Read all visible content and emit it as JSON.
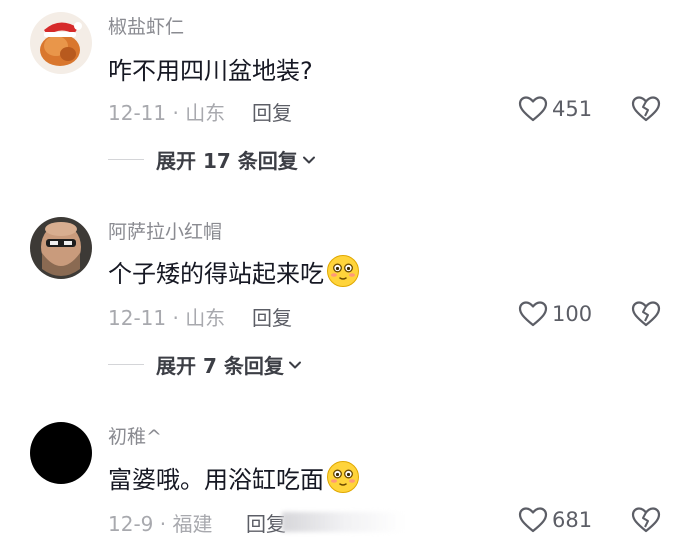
{
  "comments": [
    {
      "username": "椒盐虾仁",
      "text": "咋不用四川盆地装?",
      "meta": "12-11 · 山东",
      "reply_label": "回复",
      "likes": "451",
      "expand_label": "展开 17 条回复"
    },
    {
      "username": "阿萨拉小红帽",
      "text": "个子矮的得站起来吃",
      "meta": "12-11 · 山东",
      "reply_label": "回复",
      "likes": "100",
      "expand_label": "展开 7 条回复"
    },
    {
      "username": "初稚^",
      "text": "富婆哦。用浴缸吃面",
      "meta": "12-9 · 福建",
      "reply_label": "回复",
      "likes": "681"
    }
  ],
  "icons": {
    "like": "heart-outline-icon",
    "dislike": "broken-heart-icon",
    "expand": "chevron-down-icon",
    "emoji": "blushing-face-emoji"
  },
  "colors": {
    "username": "#8a8b91",
    "text": "#161823",
    "meta": "#a8a9ae",
    "action": "#5c5e66"
  }
}
